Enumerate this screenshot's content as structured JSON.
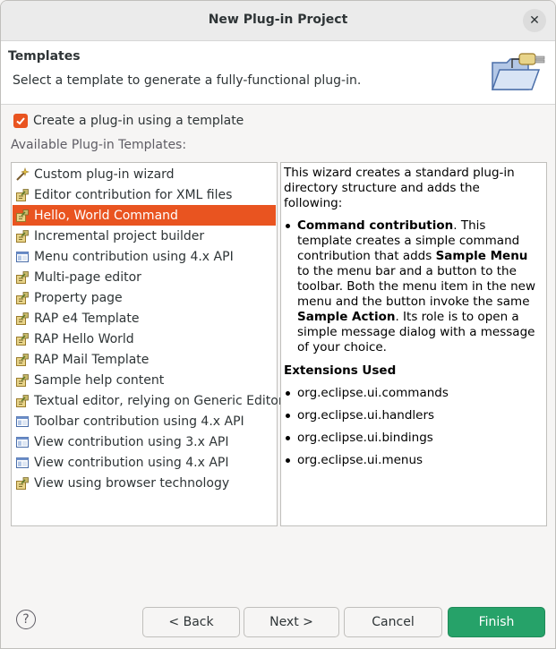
{
  "window": {
    "title": "New Plug-in Project"
  },
  "header": {
    "title": "Templates",
    "description": "Select a template to generate a fully-functional plug-in."
  },
  "checkbox": {
    "label": "Create a plug-in using a template",
    "checked": true
  },
  "available_label": "Available Plug-in Templates:",
  "templates": [
    {
      "label": "Custom plug-in wizard",
      "icon": "wizard-icon"
    },
    {
      "label": "Editor contribution for XML files",
      "icon": "plugin-icon"
    },
    {
      "label": "Hello, World Command",
      "icon": "plugin-icon",
      "selected": true
    },
    {
      "label": "Incremental project builder",
      "icon": "plugin-icon"
    },
    {
      "label": "Menu contribution using 4.x API",
      "icon": "window-icon"
    },
    {
      "label": "Multi-page editor",
      "icon": "plugin-icon"
    },
    {
      "label": "Property page",
      "icon": "plugin-icon"
    },
    {
      "label": "RAP e4 Template",
      "icon": "plugin-icon"
    },
    {
      "label": "RAP Hello World",
      "icon": "plugin-icon"
    },
    {
      "label": "RAP Mail Template",
      "icon": "plugin-icon"
    },
    {
      "label": "Sample help content",
      "icon": "plugin-icon"
    },
    {
      "label": "Textual editor, relying on Generic Editor",
      "icon": "plugin-icon"
    },
    {
      "label": "Toolbar contribution using 4.x API",
      "icon": "window-icon"
    },
    {
      "label": "View contribution using 3.x API",
      "icon": "window-icon"
    },
    {
      "label": "View contribution using 4.x API",
      "icon": "window-icon"
    },
    {
      "label": "View using browser technology",
      "icon": "plugin-icon"
    }
  ],
  "description": {
    "intro": "This wizard creates a standard plug-in directory structure and adds the following:",
    "bullet_title": "Command contribution",
    "bullet_text_1": ". This template creates a simple command contribution that adds ",
    "bullet_bold_1": "Sample Menu",
    "bullet_text_2": " to the menu bar and a button to the toolbar. Both the menu item in the new menu and the button invoke the same ",
    "bullet_bold_2": "Sample Action",
    "bullet_text_3": ". Its role is to open a simple message dialog with a message of your choice.",
    "extensions_title": "Extensions Used",
    "extensions": [
      "org.eclipse.ui.commands",
      "org.eclipse.ui.handlers",
      "org.eclipse.ui.bindings",
      "org.eclipse.ui.menus"
    ]
  },
  "buttons": {
    "help": "?",
    "back": "< Back",
    "next": "Next >",
    "cancel": "Cancel",
    "finish": "Finish"
  },
  "colors": {
    "selection": "#e95420",
    "finish": "#26a269",
    "checkbox": "#e95420"
  }
}
